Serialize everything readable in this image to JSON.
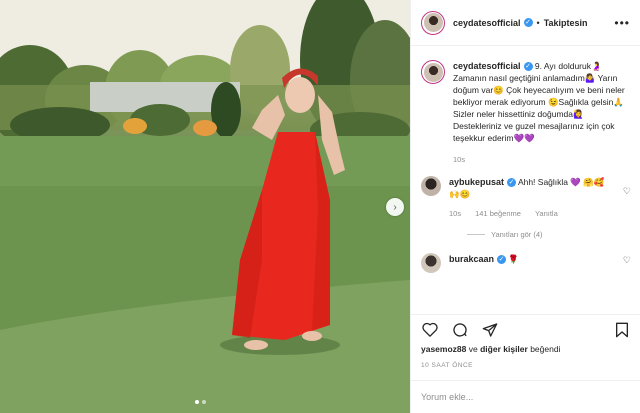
{
  "post": {
    "username": "ceydatesofficial",
    "follow_label": "Takiptesin",
    "more_label": "•••"
  },
  "photo": {
    "nav_arrow": "›",
    "slide_count": 2,
    "active_slide": 1
  },
  "caption": {
    "username": "ceydatesofficial",
    "text": "9. Ayı dolduruk🤰 Zamanın nasıl geçtiğini anlamadım🤷‍♀️ Yarın doğum var😊 Çok heyecanlıyım ve beni neler bekliyor merak ediyorum 😉Sağlıkla gelsin🙏 Sizler neler hissettiniz doğumda🙋‍♀️ Destekleriniz ve guzel mesajlarınız için çok teşekkur ederim💜💜",
    "time": "10s"
  },
  "comments": [
    {
      "username": "aybukepusat",
      "text": "Ahh! Sağlıkla 💜 🤗🥰🙌😊",
      "time": "10s",
      "likes": "141 beğenme",
      "reply_label": "Yanıtla",
      "view_replies": "Yanıtları gör (4)"
    },
    {
      "username": "burakcaan",
      "text": "🌹"
    }
  ],
  "likes": {
    "first_user": "yasemoz88",
    "connector": "ve",
    "others": "diğer kişiler",
    "suffix": "beğendi"
  },
  "timestamp": "10 SAAT ÖNCE",
  "add_comment": {
    "placeholder": "Yorum ekle..."
  },
  "icons": [
    "heart-icon",
    "comment-icon",
    "share-icon",
    "bookmark-icon",
    "verified-icon",
    "chevron-right-icon",
    "more-icon"
  ],
  "colors": {
    "verified": "#3897f0",
    "dress": "#e8281e",
    "border": "#efefef",
    "muted": "#8e8e8e"
  }
}
